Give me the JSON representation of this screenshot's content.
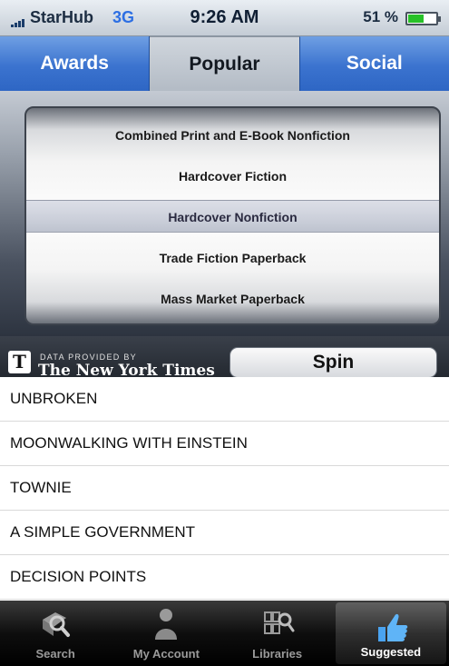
{
  "status": {
    "carrier": "StarHub",
    "network": "3G",
    "time": "9:26 AM",
    "battery": "51 %"
  },
  "tabs": [
    {
      "label": "Awards",
      "active": false
    },
    {
      "label": "Popular",
      "active": true
    },
    {
      "label": "Social",
      "active": false
    }
  ],
  "picker": {
    "options": [
      "Combined Print and E-Book Nonfiction",
      "Hardcover Fiction",
      "Hardcover Nonfiction",
      "Trade Fiction Paperback",
      "Mass Market Paperback"
    ],
    "selected": "Hardcover Nonfiction"
  },
  "attribution": {
    "small": "DATA PROVIDED BY",
    "name": "The New York Times",
    "logo": "T"
  },
  "spin_label": "Spin",
  "books": [
    "UNBROKEN",
    "MOONWALKING WITH EINSTEIN",
    "TOWNIE",
    "A SIMPLE GOVERNMENT",
    "DECISION POINTS"
  ],
  "tabbar": [
    {
      "label": "Search",
      "icon": "search-book-icon",
      "active": false
    },
    {
      "label": "My Account",
      "icon": "person-icon",
      "active": false
    },
    {
      "label": "Libraries",
      "icon": "library-search-icon",
      "active": false
    },
    {
      "label": "Suggested",
      "icon": "thumbs-up-icon",
      "active": true
    }
  ],
  "colors": {
    "tab_blue": "#3b73cf",
    "battery_green": "#28c128",
    "network_blue": "#2d6fe3"
  }
}
